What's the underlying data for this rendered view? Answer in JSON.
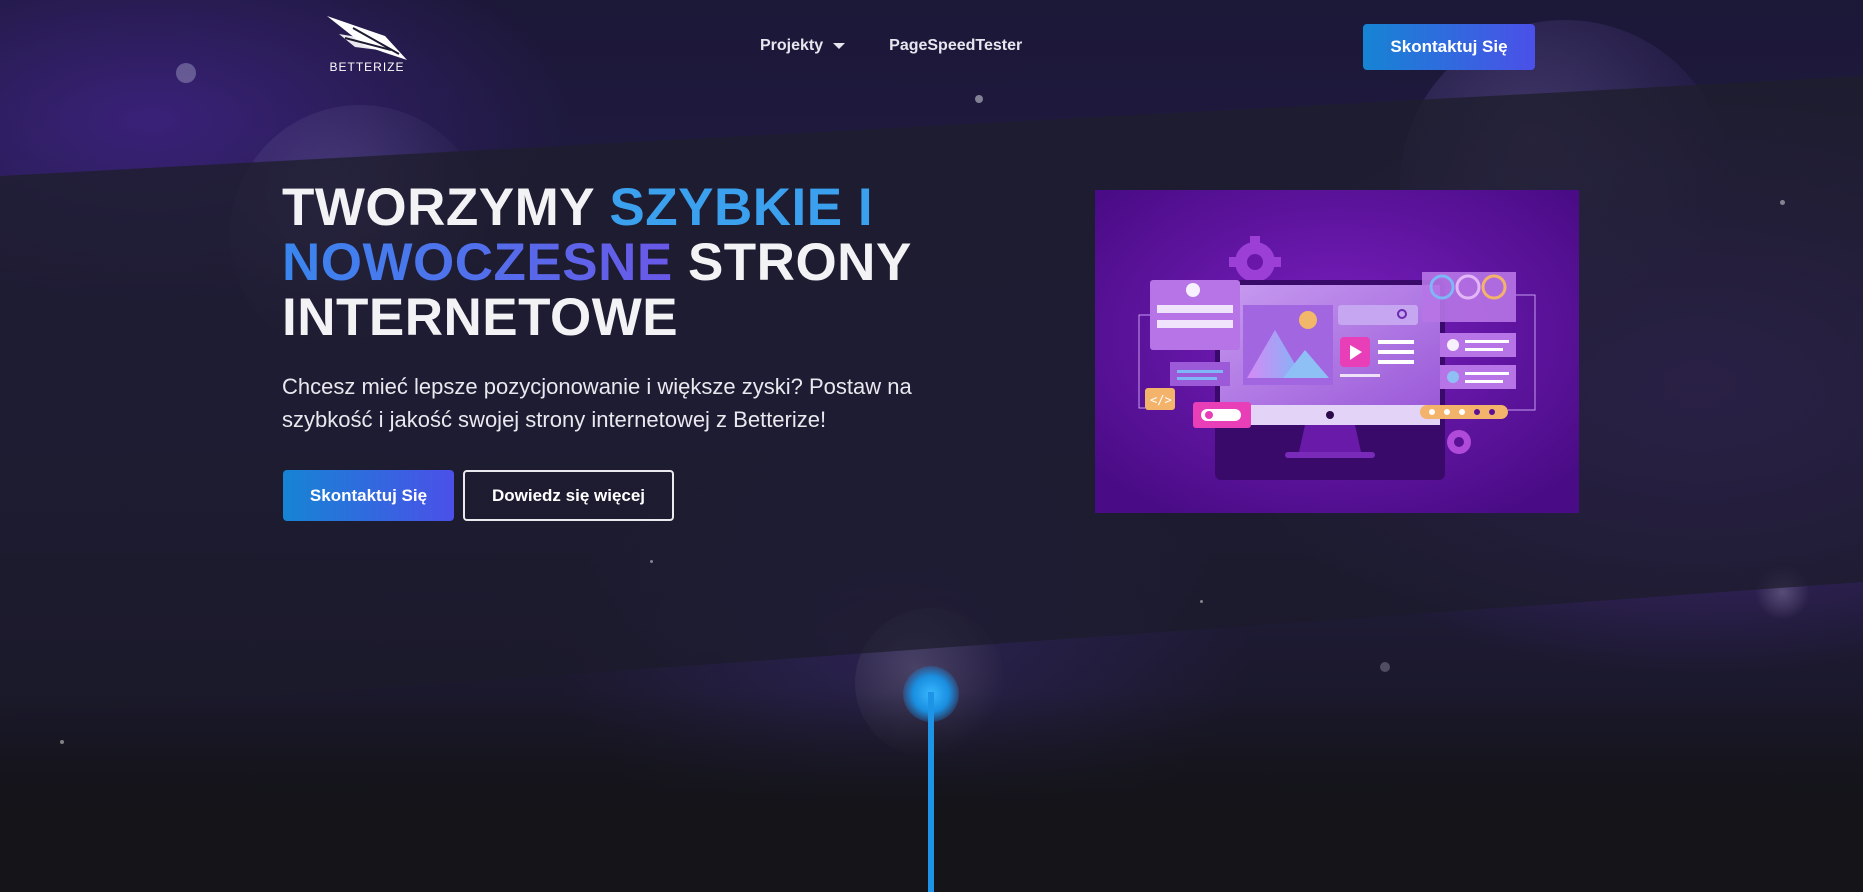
{
  "header": {
    "logo_text": "BETTERIZE",
    "nav": [
      {
        "label": "Projekty",
        "has_dropdown": true
      },
      {
        "label": "PageSpeedTester",
        "has_dropdown": false
      }
    ],
    "cta_label": "Skontaktuj Się"
  },
  "hero": {
    "title_part1": "TWORZYMY ",
    "title_highlight1": "SZYBKIE I",
    "title_highlight2": "NOWOCZESNE",
    "title_part2": " STRONY INTERNETOWE",
    "subtitle": "Chcesz mieć lepsze pozycjonowanie i większe zyski? Postaw na szybkość i jakość swojej strony internetowej z Betterize!",
    "primary_button": "Skontaktuj Się",
    "secondary_button": "Dowiedz się więcej"
  },
  "colors": {
    "accent_blue": "#1684d4",
    "accent_purple": "#4b50e8",
    "highlight_blue": "#3ba0ee",
    "illustration_bg": "#5a1196"
  },
  "icons": [
    "betterize-logo-icon",
    "chevron-down-icon",
    "monitor-illustration",
    "gear-icon",
    "search-icon",
    "play-icon",
    "star-icon",
    "code-icon",
    "user-icon"
  ]
}
